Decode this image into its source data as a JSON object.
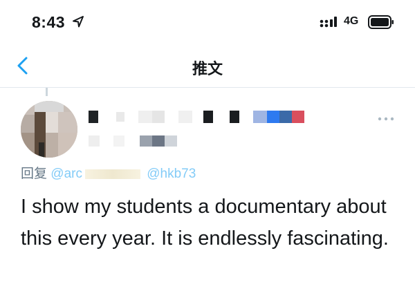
{
  "status_bar": {
    "time": "8:43",
    "network": "4G"
  },
  "nav": {
    "title": "推文"
  },
  "tweet": {
    "reply_prefix": "回复",
    "reply_mention_1": "@arc",
    "reply_mention_2": "@hkb73",
    "text": "I show my students a documentary about this every year. It is endlessly fascinating."
  },
  "colors": {
    "accent": "#1da1f2",
    "muted": "#657786",
    "text": "#14171a"
  },
  "icons": {
    "location": "location-arrow-icon",
    "signal": "cell-signal-icon",
    "battery": "battery-icon",
    "back": "chevron-left-icon",
    "more": "more-horizontal-icon"
  }
}
